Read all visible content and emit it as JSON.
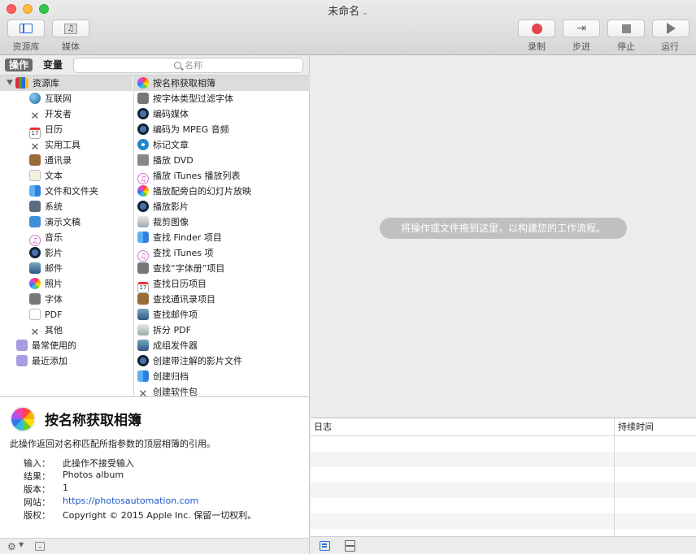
{
  "window": {
    "title": "未命名"
  },
  "toolbar": {
    "library_label": "资源库",
    "media_label": "媒体",
    "record_label": "录制",
    "step_label": "步进",
    "stop_label": "停止",
    "run_label": "运行"
  },
  "colors": {
    "accent": "#2a6fd6",
    "record": "#e0474c",
    "selection": "#dcdcdc"
  },
  "tabs": {
    "actions": "操作",
    "variables": "变量"
  },
  "search": {
    "placeholder": "名称"
  },
  "library": {
    "root": "资源库",
    "items": [
      {
        "label": "互联网",
        "icon": "globe-icon"
      },
      {
        "label": "开发者",
        "icon": "tools-icon"
      },
      {
        "label": "日历",
        "icon": "calendar-icon"
      },
      {
        "label": "实用工具",
        "icon": "tools-icon"
      },
      {
        "label": "通讯录",
        "icon": "contacts-icon"
      },
      {
        "label": "文本",
        "icon": "text-icon"
      },
      {
        "label": "文件和文件夹",
        "icon": "finder-icon"
      },
      {
        "label": "系统",
        "icon": "system-icon"
      },
      {
        "label": "演示文稿",
        "icon": "keynote-icon"
      },
      {
        "label": "音乐",
        "icon": "music-icon"
      },
      {
        "label": "影片",
        "icon": "quicktime-icon"
      },
      {
        "label": "邮件",
        "icon": "mail-icon"
      },
      {
        "label": "照片",
        "icon": "photos-icon"
      },
      {
        "label": "字体",
        "icon": "font-icon"
      },
      {
        "label": "PDF",
        "icon": "pdf-icon"
      },
      {
        "label": "其他",
        "icon": "tools-icon"
      }
    ],
    "smart": [
      {
        "label": "最常使用的",
        "icon": "smart-folder-icon"
      },
      {
        "label": "最近添加",
        "icon": "smart-folder-icon"
      }
    ]
  },
  "actions": [
    {
      "label": "按名称获取相簿",
      "icon": "photos-icon"
    },
    {
      "label": "按字体类型过滤字体",
      "icon": "font-icon"
    },
    {
      "label": "编码媒体",
      "icon": "quicktime-icon"
    },
    {
      "label": "编码为 MPEG 音频",
      "icon": "quicktime-icon"
    },
    {
      "label": "标记文章",
      "icon": "safari-icon"
    },
    {
      "label": "播放 DVD",
      "icon": "dvd-icon"
    },
    {
      "label": "播放 iTunes 播放列表",
      "icon": "music-icon"
    },
    {
      "label": "播放配旁白的幻灯片放映",
      "icon": "photos-icon"
    },
    {
      "label": "播放影片",
      "icon": "quicktime-icon"
    },
    {
      "label": "裁剪图像",
      "icon": "preview-icon"
    },
    {
      "label": "查找 Finder 项目",
      "icon": "finder-icon"
    },
    {
      "label": "查找 iTunes 项",
      "icon": "music-icon"
    },
    {
      "label": "查找“字体册”项目",
      "icon": "font-icon"
    },
    {
      "label": "查找日历项目",
      "icon": "calendar-icon"
    },
    {
      "label": "查找通讯录项目",
      "icon": "contacts-icon"
    },
    {
      "label": "查找邮件项",
      "icon": "mail-icon"
    },
    {
      "label": "拆分 PDF",
      "icon": "preview-icon"
    },
    {
      "label": "成组发件器",
      "icon": "mail-icon"
    },
    {
      "label": "创建带注解的影片文件",
      "icon": "quicktime-icon"
    },
    {
      "label": "创建归档",
      "icon": "finder-icon"
    },
    {
      "label": "创建软件包",
      "icon": "tools-icon"
    }
  ],
  "description": {
    "title": "按名称获取相簿",
    "text": "此操作返回对名称匹配所指参数的顶层相簿的引用。",
    "fields": [
      {
        "key": "输入：",
        "value": "此操作不接受输入",
        "link": false
      },
      {
        "key": "结果：",
        "value": "Photos album",
        "link": false
      },
      {
        "key": "版本：",
        "value": "1",
        "link": false
      },
      {
        "key": "网站：",
        "value": "https://photosautomation.com",
        "link": true
      },
      {
        "key": "版权：",
        "value": "Copyright © 2015 Apple Inc. 保留一切权利。",
        "link": false
      }
    ]
  },
  "workflow": {
    "hint": "将操作或文件拖到这里，以构建您的工作流程。"
  },
  "log": {
    "col_log": "日志",
    "col_duration": "持续时间"
  }
}
